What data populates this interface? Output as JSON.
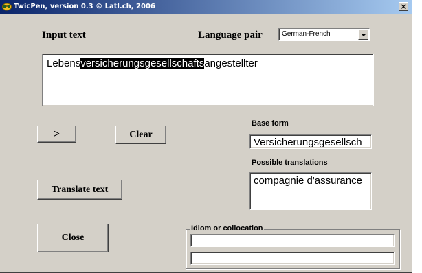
{
  "window": {
    "title": "TwicPen, version 0.3 © Latl.ch, 2006",
    "close_glyph": "×"
  },
  "labels": {
    "input_text": "Input text",
    "language_pair": "Language pair",
    "base_form": "Base form",
    "possible_translations": "Possible translations",
    "idiom": "Idiom or collocation"
  },
  "language_select": {
    "value": "German-French"
  },
  "input": {
    "before": "Lebens",
    "selected": "versicherungsgesellschafts",
    "after": "angestellter"
  },
  "buttons": {
    "arrow": ">",
    "clear": "Clear",
    "translate": "Translate text",
    "close": "Close"
  },
  "base_form_value": "Versicherungsgesellsch",
  "translations_value": "compagnie d'assurance",
  "idiom_field_1": "",
  "idiom_field_2": ""
}
